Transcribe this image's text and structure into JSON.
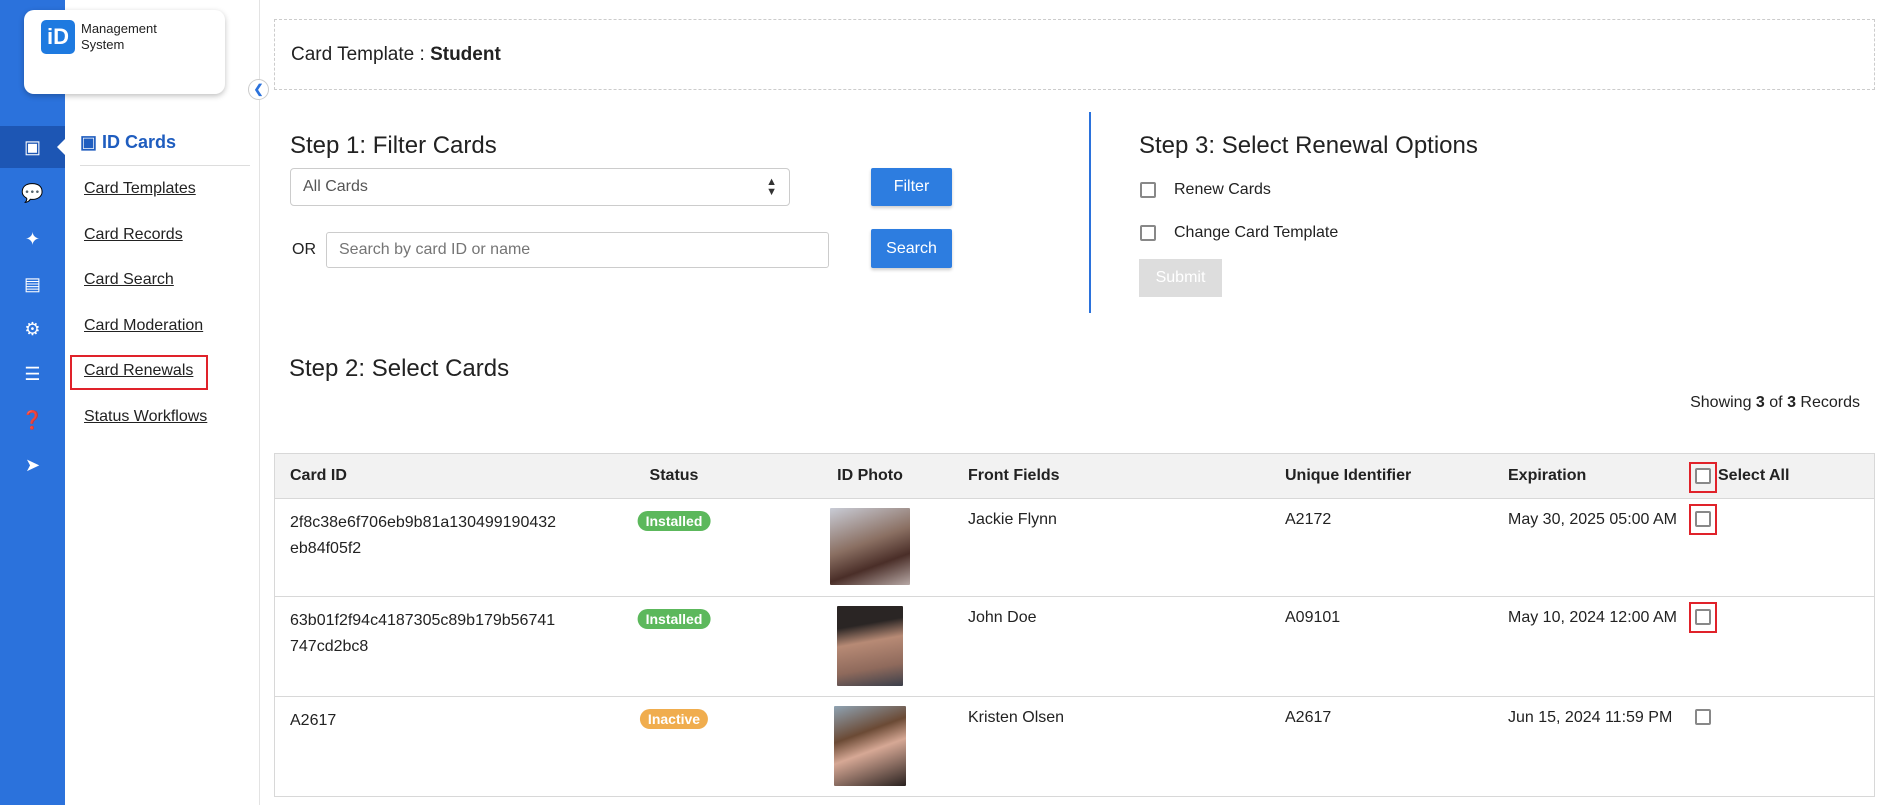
{
  "app": {
    "logo_mark": "iD",
    "logo_text_1": "Management",
    "logo_text_2": "System"
  },
  "rail": [
    {
      "icon": "id-card-icon",
      "active": true
    },
    {
      "icon": "chat-icon"
    },
    {
      "icon": "plug-icon"
    },
    {
      "icon": "invoice-icon"
    },
    {
      "icon": "gear-icon"
    },
    {
      "icon": "list-icon"
    },
    {
      "icon": "help-icon"
    },
    {
      "icon": "logout-icon"
    }
  ],
  "sidebar": {
    "title": "ID Cards",
    "items": [
      "Card Templates",
      "Card Records",
      "Card Search",
      "Card Moderation",
      "Card Renewals",
      "Status Workflows"
    ]
  },
  "header": {
    "prefix": "Card Template : ",
    "template": "Student"
  },
  "step1": {
    "title": "Step 1: Filter Cards",
    "select_value": "All Cards",
    "filter_label": "Filter",
    "or_label": "OR",
    "search_placeholder": "Search by card ID or name",
    "search_label": "Search"
  },
  "step3": {
    "title": "Step 3: Select Renewal Options",
    "opt1": "Renew Cards",
    "opt2": "Change Card Template",
    "submit": "Submit"
  },
  "step2": {
    "title": "Step 2: Select Cards",
    "showing_prefix": "Showing ",
    "shown": "3",
    "of": " of ",
    "total": "3",
    "records": " Records"
  },
  "table": {
    "headers": [
      "Card ID",
      "Status",
      "ID Photo",
      "Front Fields",
      "Unique Identifier",
      "Expiration",
      "Select All"
    ],
    "rows": [
      {
        "id1": "2f8c38e6f706eb9b81a130499190432",
        "id2": "eb84f05f2",
        "status": "Installed",
        "name": "Jackie Flynn",
        "uid": "A2172",
        "exp": "May 30, 2025 05:00 AM"
      },
      {
        "id1": "63b01f2f94c4187305c89b179b56741",
        "id2": "747cd2bc8",
        "status": "Installed",
        "name": "John Doe",
        "uid": "A09101",
        "exp": "May 10, 2024 12:00 AM"
      },
      {
        "id1": "A2617",
        "id2": "",
        "status": "Inactive",
        "name": "Kristen Olsen",
        "uid": "A2617",
        "exp": "Jun 15, 2024 11:59 PM"
      }
    ]
  },
  "colors": {
    "brand": "#2b72dc",
    "installed": "#5cb85c",
    "inactive": "#f0ad4e",
    "highlight": "#e0222a"
  }
}
